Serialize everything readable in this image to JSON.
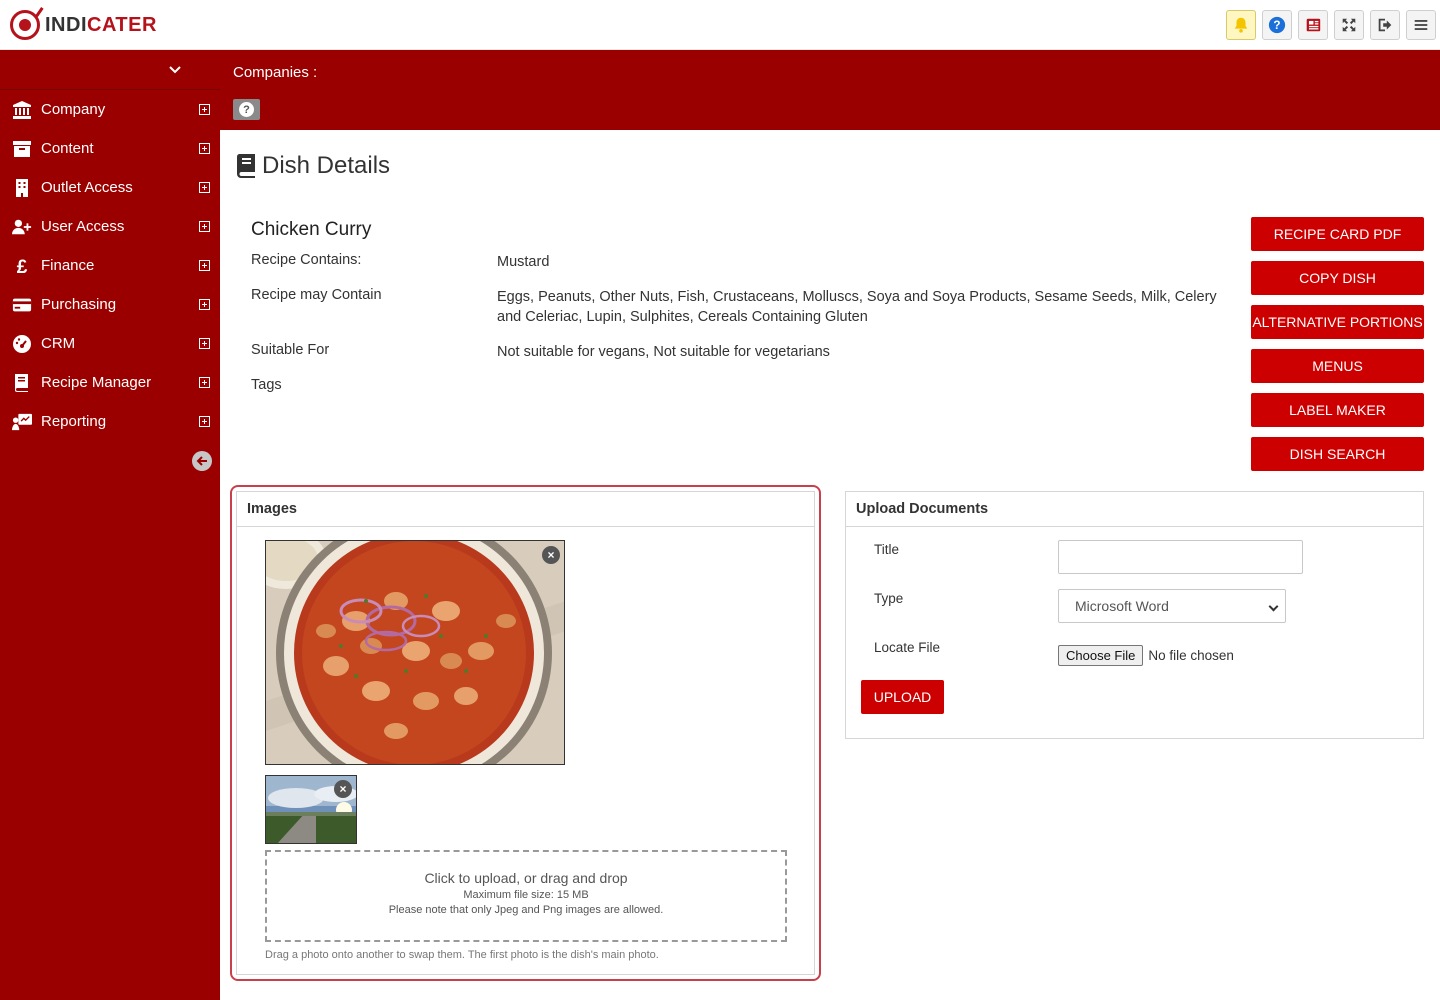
{
  "brand": {
    "prefix": "INDI",
    "suffix": "CATER",
    "accent": "#9b0000",
    "button_color": "#cc0000"
  },
  "top_icons": [
    "bell-icon",
    "help-icon",
    "newspaper-icon",
    "expand-icon",
    "logout-icon",
    "menu-icon"
  ],
  "sidebar": {
    "items": [
      {
        "label": "Company",
        "icon": "bank-icon"
      },
      {
        "label": "Content",
        "icon": "archive-icon"
      },
      {
        "label": "Outlet Access",
        "icon": "building-icon"
      },
      {
        "label": "User Access",
        "icon": "user-plus-icon"
      },
      {
        "label": "Finance",
        "icon": "pound-icon"
      },
      {
        "label": "Purchasing",
        "icon": "credit-card-icon"
      },
      {
        "label": "CRM",
        "icon": "dashboard-icon"
      },
      {
        "label": "Recipe Manager",
        "icon": "book-icon"
      },
      {
        "label": "Reporting",
        "icon": "presentation-icon"
      }
    ]
  },
  "band": {
    "companies_label": "Companies :",
    "help_glyph": "?"
  },
  "page": {
    "title": "Dish Details"
  },
  "dish": {
    "name": "Chicken Curry",
    "rows": [
      {
        "key": "Recipe Contains:",
        "value": "Mustard"
      },
      {
        "key": "Recipe may Contain",
        "value": "Eggs, Peanuts, Other Nuts, Fish, Crustaceans, Molluscs, Soya and Soya Products, Sesame Seeds, Milk, Celery and Celeriac, Lupin, Sulphites, Cereals Containing Gluten"
      },
      {
        "key": "Suitable For",
        "value": "Not suitable for vegans, Not suitable for vegetarians"
      },
      {
        "key": "Tags",
        "value": ""
      }
    ]
  },
  "actions": [
    "RECIPE CARD PDF",
    "COPY DISH",
    "ALTERNATIVE PORTIONS",
    "MENUS",
    "LABEL MAKER",
    "DISH SEARCH"
  ],
  "images_panel": {
    "heading": "Images",
    "remove_glyph": "×",
    "dropzone_main": "Click to upload, or drag and drop",
    "dropzone_size": "Maximum file size: 15 MB",
    "dropzone_types": "Please note that only Jpeg and Png images are allowed.",
    "note": "Drag a photo onto another to swap them. The first photo is the dish's main photo."
  },
  "upload_panel": {
    "heading": "Upload Documents",
    "title_label": "Title",
    "title_value": "",
    "type_label": "Type",
    "type_value": "Microsoft Word",
    "file_label": "Locate File",
    "choose_file": "Choose File",
    "no_file": "No file chosen",
    "upload_button": "UPLOAD"
  }
}
